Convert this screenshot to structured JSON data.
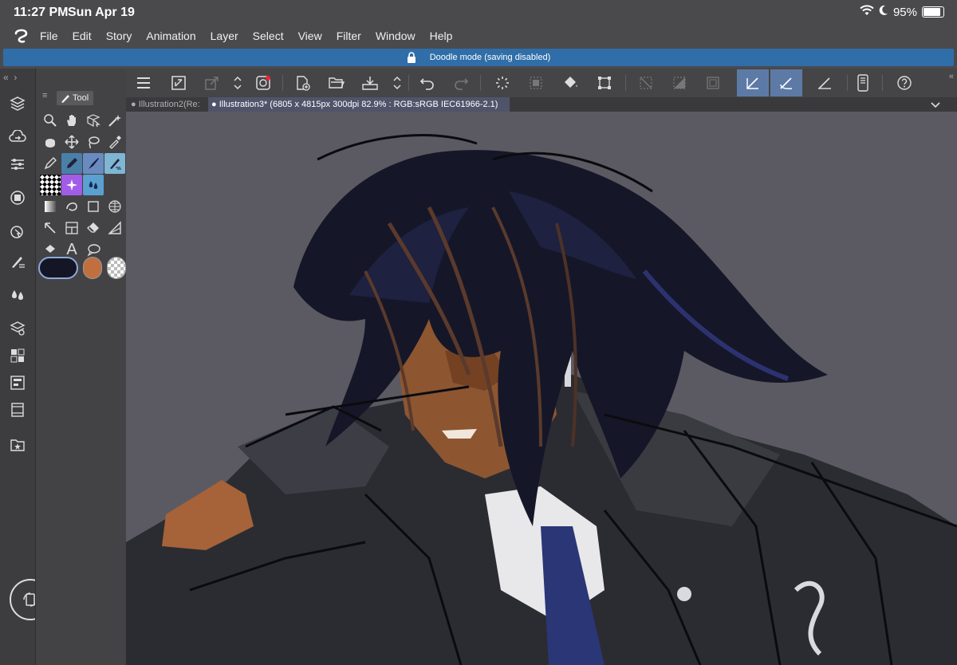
{
  "status": {
    "time": "11:27 PM",
    "date": "Sun Apr 19",
    "battery": "95%",
    "battery_level": 0.95
  },
  "menu": [
    "File",
    "Edit",
    "Story",
    "Animation",
    "Layer",
    "Select",
    "View",
    "Filter",
    "Window",
    "Help"
  ],
  "banner": {
    "text": "Doodle mode (saving disabled)"
  },
  "tool_panel": {
    "tab_label": "Tool"
  },
  "colors": {
    "main": "#141625",
    "sub": "#c0703e",
    "accent": "#2f6ea8"
  },
  "tabs": [
    {
      "label": "Illustration2(Re:"
    },
    {
      "label": "Illustration3* (6805 x 4815px 300dpi 82.9% : RGB:sRGB IEC61966-2.1)"
    }
  ]
}
